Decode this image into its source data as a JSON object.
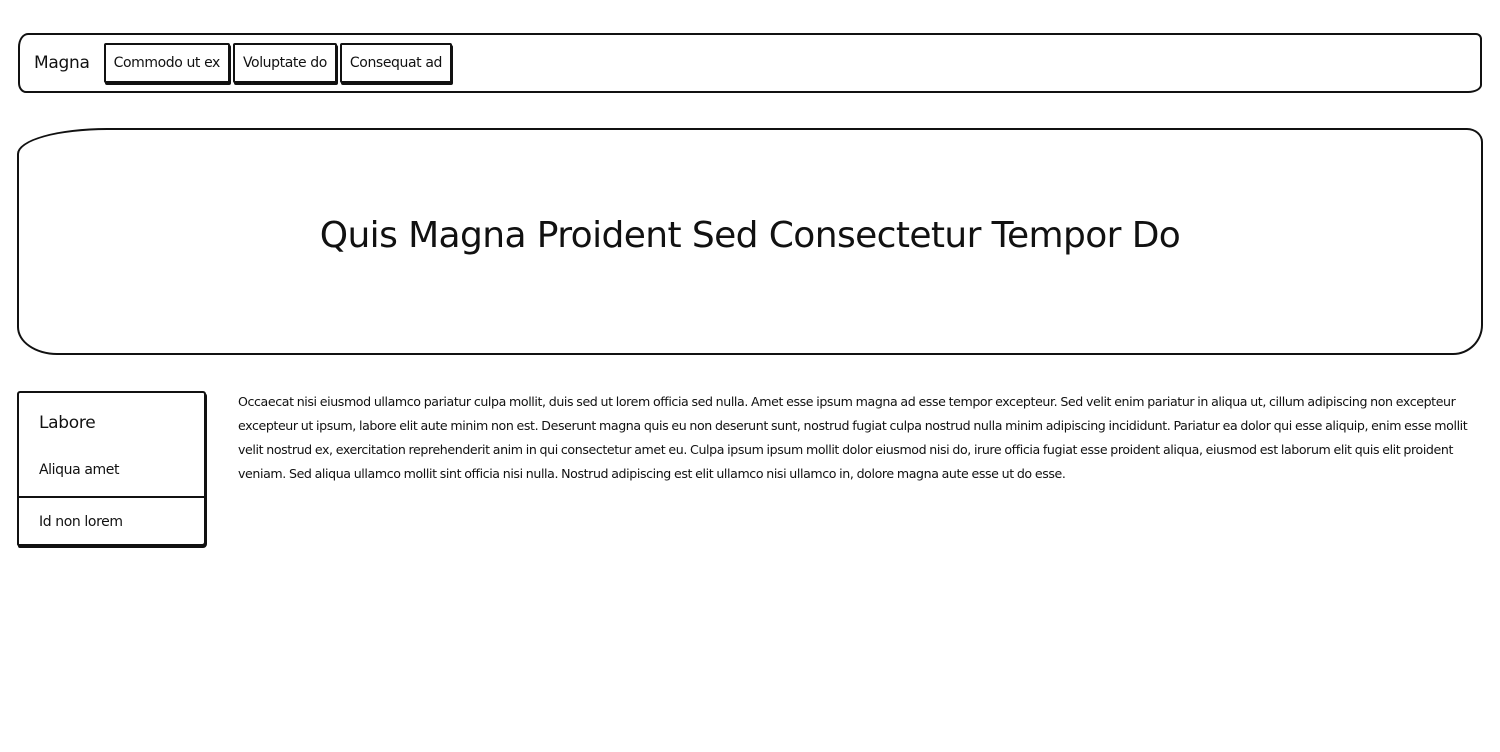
{
  "navbar": {
    "brand": "Magna",
    "buttons": [
      "Commodo ut ex",
      "Voluptate do",
      "Consequat ad"
    ]
  },
  "hero": {
    "title": "Quis Magna Proident Sed Consectetur Tempor Do"
  },
  "sidebar": {
    "header": "Labore",
    "items": [
      "Aliqua amet",
      "Id non lorem"
    ]
  },
  "content": {
    "paragraph": "Occaecat nisi eiusmod ullamco pariatur culpa mollit, duis sed ut lorem officia sed nulla. Amet esse ipsum magna ad esse tempor excepteur. Sed velit enim pariatur in aliqua ut, cillum adipiscing non excepteur excepteur ut ipsum, labore elit aute minim non est. Deserunt magna quis eu non deserunt sunt, nostrud fugiat culpa nostrud nulla minim adipiscing incididunt. Pariatur ea dolor qui esse aliquip, enim esse mollit velit nostrud ex, exercitation reprehenderit anim in qui consectetur amet eu. Culpa ipsum ipsum mollit dolor eiusmod nisi do, irure officia fugiat esse proident aliqua, eiusmod est laborum elit quis elit proident veniam. Sed aliqua ullamco mollit sint officia nisi nulla. Nostrud adipiscing est elit ullamco nisi ullamco in, dolore magna aute esse ut do esse."
  }
}
